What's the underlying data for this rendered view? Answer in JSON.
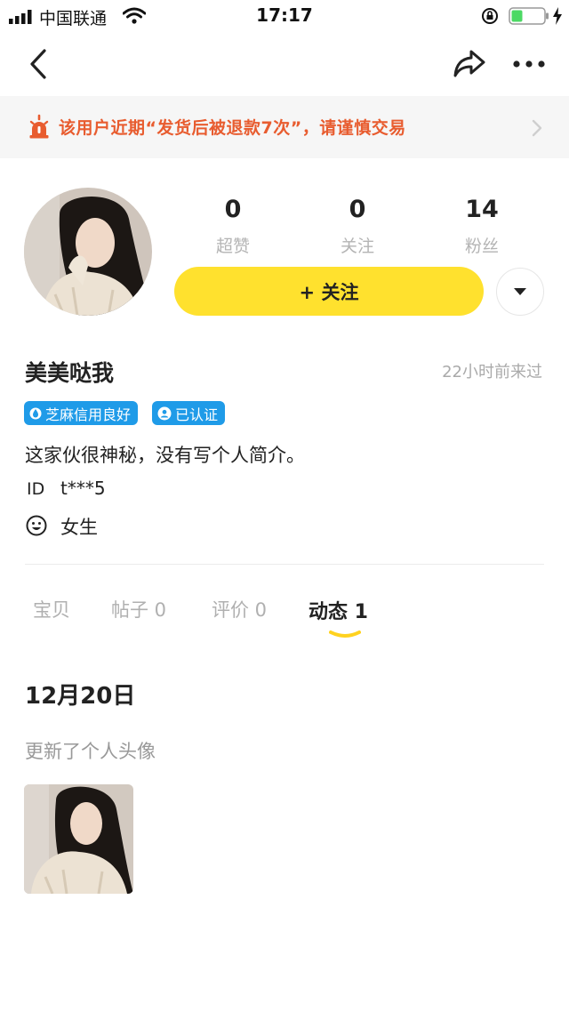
{
  "status_bar": {
    "carrier": "中国联通",
    "time": "17:17"
  },
  "banner": {
    "text": "该用户近期“发货后被退款7次”，请谨慎交易",
    "accent": "#e85c2f"
  },
  "stats": [
    {
      "value": "0",
      "label": "超赞"
    },
    {
      "value": "0",
      "label": "关注"
    },
    {
      "value": "14",
      "label": "粉丝"
    }
  ],
  "follow_button": {
    "label": "+ 关注",
    "color": "#ffe12e"
  },
  "profile": {
    "username": "美美哒我",
    "last_seen": "22小时前来过",
    "badges": [
      {
        "label": "芝麻信用良好",
        "icon": "water-drop-icon"
      },
      {
        "label": "已认证",
        "icon": "verified-user-icon"
      }
    ],
    "bio": "这家伙很神秘，没有写个人简介。",
    "id_label": "ID",
    "id_value": "t***5",
    "gender": "女生"
  },
  "tabs": [
    {
      "label": "宝贝"
    },
    {
      "label": "帖子 0"
    },
    {
      "label": "评价 0"
    },
    {
      "label": "动态 1",
      "active": true
    }
  ],
  "feed": {
    "date": "12月20日",
    "event": "更新了个人头像"
  }
}
